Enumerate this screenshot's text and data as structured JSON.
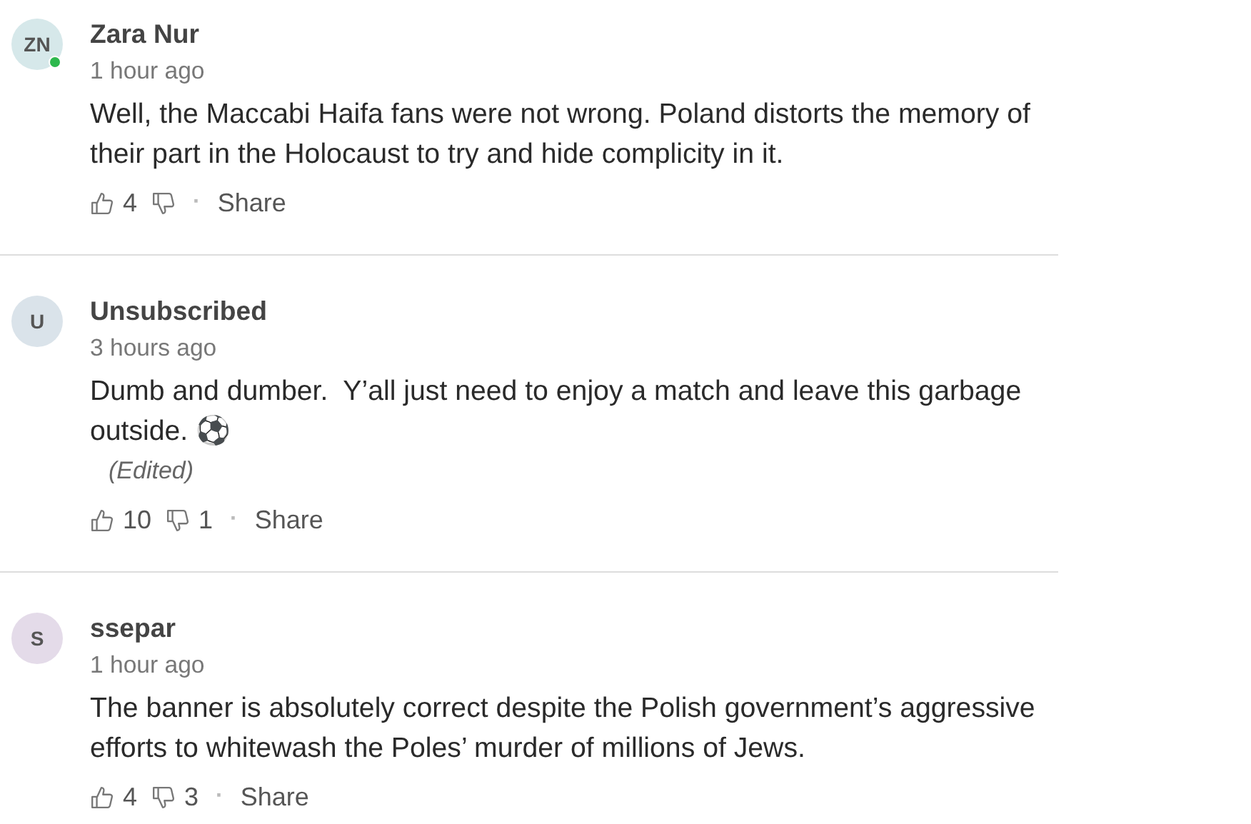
{
  "comments": [
    {
      "avatar": {
        "initials": "ZN",
        "color": "#d6e8ea",
        "online": true
      },
      "author": "Zara Nur",
      "time": "1 hour ago",
      "body": "Well, the Maccabi Haifa fans were not wrong. Poland distorts the memory of their part in the Holocaust to try and hide complicity in it.",
      "likes": "4",
      "separator": "·",
      "share": "Share"
    },
    {
      "avatar": {
        "initials": "U",
        "color": "#dae3ea",
        "online": false
      },
      "author": "Unsubscribed",
      "time": "3 hours ago",
      "body": "Dumb and dumber.  Y’all just need to enjoy a match and leave this garbage outside. ⚽",
      "edited_note": "(Edited)",
      "likes": "10",
      "dislikes": "1",
      "separator": "·",
      "share": "Share"
    },
    {
      "avatar": {
        "initials": "S",
        "color": "#e4dbe9",
        "online": false
      },
      "author": "ssepar",
      "time": "1 hour ago",
      "body": "The banner is absolutely correct despite the Polish government’s aggressive efforts to whitewash the Poles’ murder of millions of Jews.",
      "likes": "4",
      "dislikes": "3",
      "separator": "·",
      "share": "Share"
    }
  ]
}
